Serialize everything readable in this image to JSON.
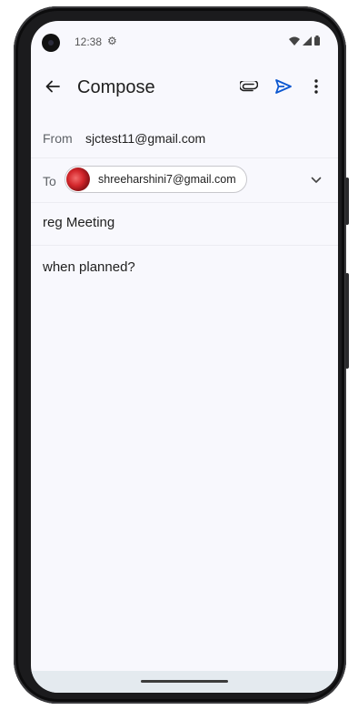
{
  "status_bar": {
    "time": "12:38",
    "icons": [
      "settings-icon",
      "wifi-icon",
      "signal-icon",
      "battery-icon"
    ]
  },
  "app_bar": {
    "title": "Compose",
    "icons": [
      "arrow-back-icon",
      "attach-icon",
      "send-icon",
      "more-vert-icon"
    ],
    "accent_color": "#0b57d0"
  },
  "from": {
    "label": "From",
    "value": "sjctest11@gmail.com"
  },
  "to": {
    "label": "To",
    "recipients": [
      {
        "email": "shreeharshini7@gmail.com"
      }
    ]
  },
  "subject": {
    "value": "reg Meeting"
  },
  "body": {
    "value": "when planned?"
  }
}
